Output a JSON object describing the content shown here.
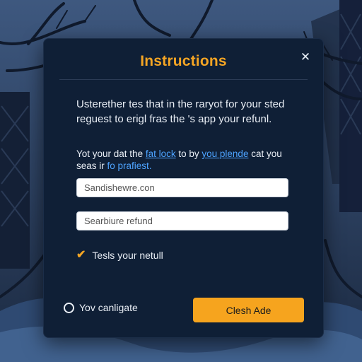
{
  "modal": {
    "title": "Instructions",
    "close_icon": "close-icon",
    "description": "Usterether tes that in the raryot for your sted reguest to erigl fras the 's app your refunl.",
    "info": {
      "part1": "Yot your dat the ",
      "link1": "fat lock",
      "part2": " to by ",
      "link2": "you plende",
      "part3": " cat you seas ir ",
      "accent": "fo prafiest."
    },
    "fields": {
      "email_placeholder": "Sandishewre.con",
      "refund_placeholder": "Searbiure refund"
    },
    "checkbox": {
      "checked": true,
      "icon": "checkmark-icon",
      "label": "Tesls your netull"
    },
    "radio": {
      "selected": false,
      "label": "Yov canligate"
    },
    "primary_button": "Clesh Ade"
  },
  "colors": {
    "accent": "#f5a524",
    "link": "#4da3ff",
    "panel": "#0f1f36",
    "text": "#e9eef5"
  }
}
